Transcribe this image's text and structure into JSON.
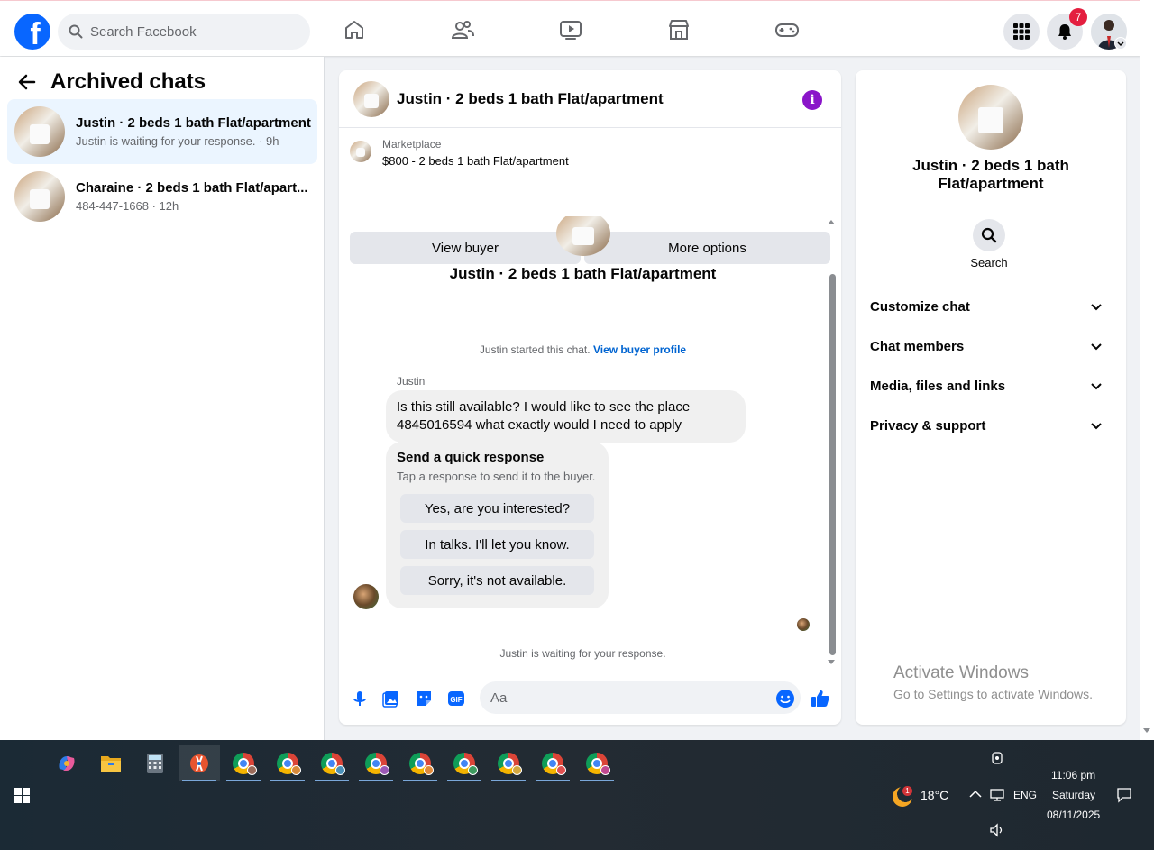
{
  "colors": {
    "brand": "#0866ff",
    "accent_purple": "#8a15c9",
    "link": "#0064d1",
    "badge": "#e41e3f"
  },
  "topbar": {
    "search_placeholder": "Search Facebook",
    "notification_count": "7",
    "nav_icons": [
      "home-icon",
      "friends-icon",
      "video-icon",
      "marketplace-icon",
      "gaming-icon"
    ]
  },
  "sidebar": {
    "title": "Archived chats",
    "chats": [
      {
        "name": "Justin · 2 beds 1 bath Flat/apartment",
        "sub": "Justin is waiting for your response. · 9h"
      },
      {
        "name": "Charaine · 2 beds 1 bath Flat/apart...",
        "sub": "484-447-1668 · 12h"
      }
    ]
  },
  "chat": {
    "header_title": "Justin · 2 beds 1 bath Flat/apartment",
    "marketplace_label": "Marketplace",
    "listing": "$800 - 2 beds 1 bath Flat/apartment",
    "view_buyer": "View buyer",
    "more_options": "More options",
    "conversation_title": "Justin · 2 beds 1 bath Flat/apartment",
    "started_text": "Justin started this chat.",
    "view_profile_link": "View buyer profile",
    "sender": "Justin",
    "message_line1": "Is this still available? I would like to see the place",
    "message_line2": "4845016594 what exactly would I need to apply",
    "quick_title": "Send a quick response",
    "quick_sub": "Tap a response to send it to the buyer.",
    "quick_options": [
      "Yes, are you interested?",
      "In talks. I'll let you know.",
      "Sorry, it's not available."
    ],
    "waiting_text": "Justin is waiting for your response.",
    "input_placeholder": "Aa"
  },
  "info": {
    "name": "Justin · 2 beds 1 bath Flat/apartment",
    "search_label": "Search",
    "sections": [
      "Customize chat",
      "Chat members",
      "Media, files and links",
      "Privacy & support"
    ]
  },
  "watermark": {
    "title": "Activate Windows",
    "subtitle": "Go to Settings to activate Windows."
  },
  "taskbar": {
    "temperature": "18°C",
    "weather_alert": "1",
    "language": "ENG",
    "time": "11:06 pm",
    "day": "Saturday",
    "date": "08/11/2025",
    "chrome_profiles": [
      "#9a6b5a",
      "#d88a3b",
      "#4a90b8",
      "#9b59b6",
      "#e08a3b",
      "#3f9b5f",
      "#d4a840",
      "#e05050",
      "#c04890"
    ]
  }
}
